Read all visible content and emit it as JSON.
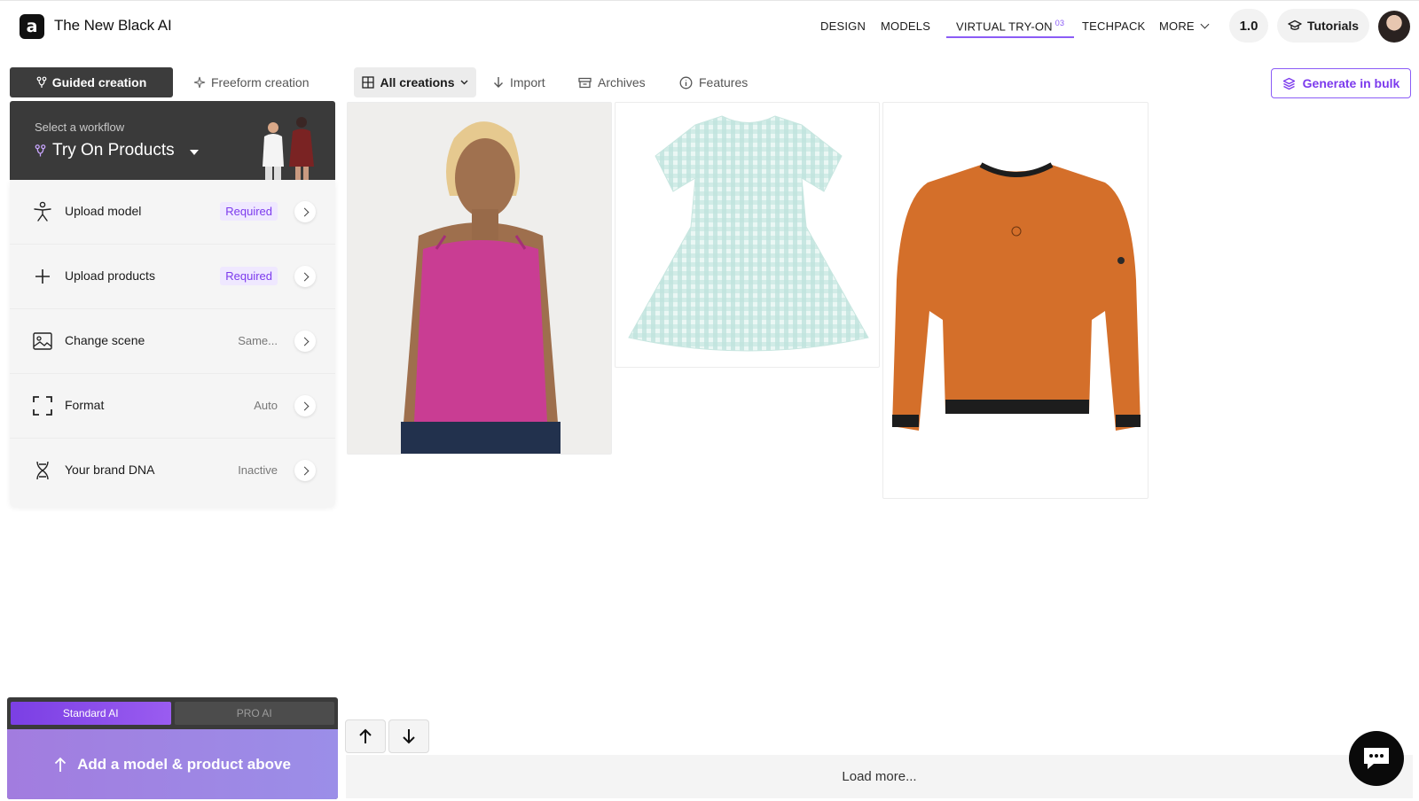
{
  "app": {
    "title": "The New Black AI",
    "logo_glyph": "a"
  },
  "nav": {
    "items": [
      "DESIGN",
      "MODELS"
    ],
    "active": {
      "label": "VIRTUAL TRY-ON",
      "badge": "03"
    },
    "techpack": "TECHPACK",
    "more": "MORE",
    "version": "1.0",
    "tutorials": "Tutorials"
  },
  "modes": {
    "guided": "Guided creation",
    "freeform": "Freeform creation"
  },
  "toolbar": {
    "all_creations": "All creations",
    "import": "Import",
    "archives": "Archives",
    "features": "Features",
    "generate_bulk": "Generate in bulk"
  },
  "workflow": {
    "label": "Select a workflow",
    "value": "Try On Products"
  },
  "options": [
    {
      "label": "Upload model",
      "value": "Required",
      "icon": "person-icon",
      "required": true
    },
    {
      "label": "Upload products",
      "value": "Required",
      "icon": "plus-icon",
      "required": true
    },
    {
      "label": "Change scene",
      "value": "Same...",
      "icon": "image-icon",
      "required": false
    },
    {
      "label": "Format",
      "value": "Auto",
      "icon": "crop-frame-icon",
      "required": false
    },
    {
      "label": "Your brand DNA",
      "value": "Inactive",
      "icon": "dna-icon",
      "required": false
    }
  ],
  "ai_mode": {
    "standard": "Standard AI",
    "pro": "PRO AI"
  },
  "generate": {
    "label": "Add a model & product above"
  },
  "load_more": "Load more...",
  "colors": {
    "accent": "#8b5cf6",
    "dark_panel": "#3a3a3a",
    "tank_top": "#c93d93",
    "dress": "#cfe9e4",
    "sweater": "#d46f2a"
  }
}
